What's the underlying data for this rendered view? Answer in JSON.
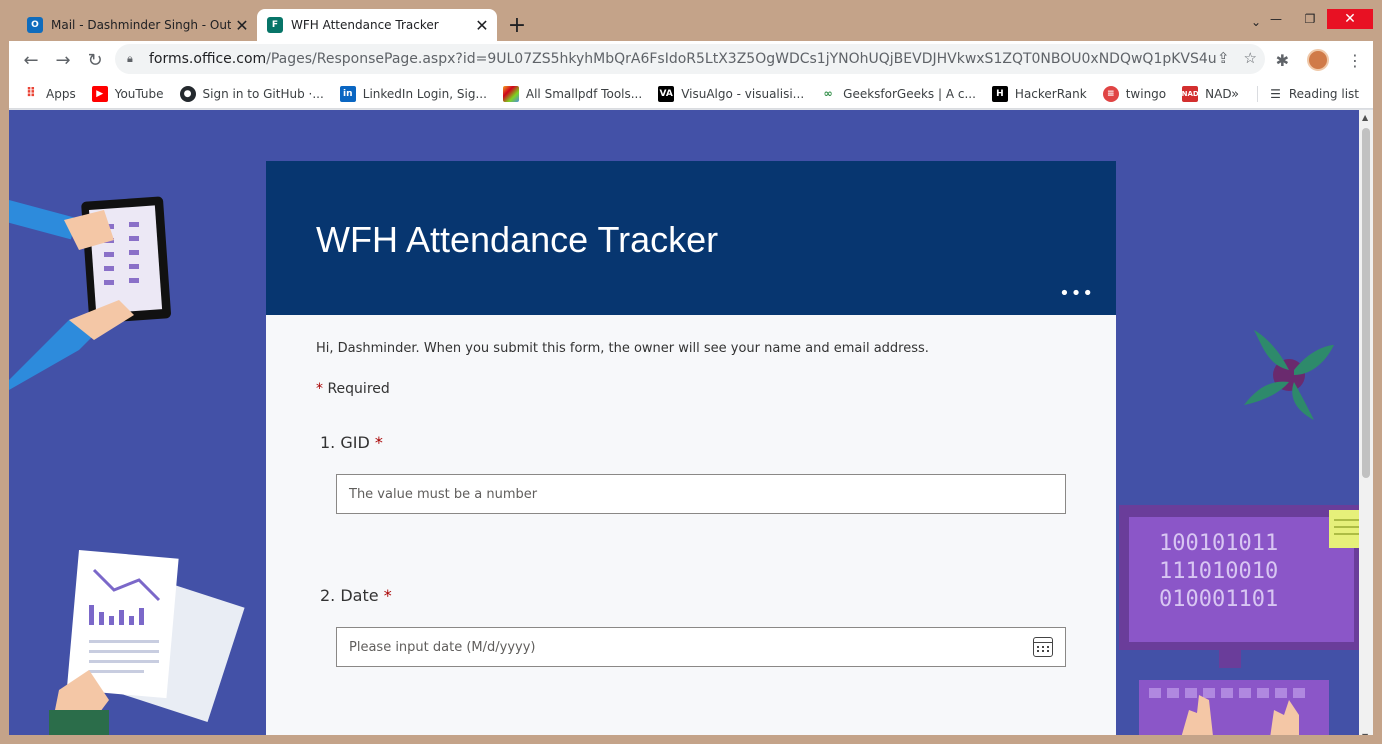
{
  "tabs": [
    {
      "title": "Mail - Dashminder Singh - Outlo",
      "icon": "outlook-icon",
      "active": false,
      "color": "#0f6cbd"
    },
    {
      "title": "WFH Attendance Tracker",
      "icon": "forms-icon",
      "active": true,
      "color": "#077568"
    }
  ],
  "toolbar": {
    "url_host": "forms.office.com",
    "url_path": "/Pages/ResponsePage.aspx?id=9UL07ZS5hkyhMbQrA6FsIdoR5LtX3Z5OgWDCs1jYNOhUQjBEVDJHVkwxS1ZQT0NBOU0xNDQwQ1pKVS4u"
  },
  "bookmarks": [
    {
      "label": "Apps",
      "icon": "apps-grid-icon",
      "color": "#ea4335"
    },
    {
      "label": "YouTube",
      "icon": "youtube-icon",
      "color": "#ff0000"
    },
    {
      "label": "Sign in to GitHub ·...",
      "icon": "github-icon",
      "color": "#24292e"
    },
    {
      "label": "LinkedIn Login, Sig...",
      "icon": "linkedin-icon",
      "color": "#0a66c2"
    },
    {
      "label": "All Smallpdf Tools...",
      "icon": "smallpdf-icon",
      "color": "#f5a623"
    },
    {
      "label": "VisuAlgo - visualisi...",
      "icon": "visualgo-icon",
      "color": "#000000"
    },
    {
      "label": "GeeksforGeeks | A c...",
      "icon": "geeksforgeeks-icon",
      "color": "#2f8d46"
    },
    {
      "label": "HackerRank",
      "icon": "hackerrank-icon",
      "color": "#000000"
    },
    {
      "label": "twingo",
      "icon": "twingo-icon",
      "color": "#e04444"
    },
    {
      "label": "NAD",
      "icon": "nad-icon",
      "color": "#d32f2f"
    }
  ],
  "reading_list": "Reading list",
  "form": {
    "title": "WFH Attendance Tracker",
    "greeting": "Hi, Dashminder. When you submit this form, the owner will see your name and email address.",
    "required_note": "Required",
    "questions": [
      {
        "number": "1.",
        "label": "GID",
        "placeholder": "The value must be a number"
      },
      {
        "number": "2.",
        "label": "Date",
        "placeholder": "Please input date (M/d/yyyy)"
      }
    ]
  },
  "colors": {
    "page_bg": "#4351a7",
    "header_bg": "#073670",
    "required_star": "#a80000"
  }
}
